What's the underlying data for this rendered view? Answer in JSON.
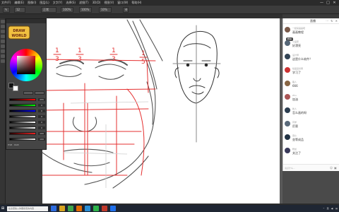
{
  "menubar": {
    "items": [
      "文件(F)",
      "编辑(E)",
      "图像(I)",
      "图层(L)",
      "文字(Y)",
      "选择(S)",
      "滤镜(T)",
      "3D(D)",
      "视图(V)",
      "窗口(W)",
      "帮助(H)"
    ]
  },
  "window_controls": {
    "minimize": "—",
    "maximize": "□",
    "close": "✕"
  },
  "options": {
    "brush_size": "12",
    "mode": "正常",
    "opacity": "100%",
    "flow": "100%",
    "smoothing": "10%"
  },
  "color_panel": {
    "slider_values": [
      "255",
      "0",
      "0",
      "0",
      "0",
      "0",
      "100",
      "100"
    ],
    "footer": "HSB · RGB"
  },
  "chat": {
    "title": "直播",
    "header_icons": [
      "⋯",
      "↻",
      "✕"
    ],
    "messages": [
      {
        "user": "一起来画画吧",
        "text": "画画教程",
        "badge": "粉丝",
        "color": "#7a5a4a"
      },
      {
        "user": "小画家",
        "text": "好漂亮",
        "badge": "",
        "color": "#556677"
      },
      {
        "user": "设计师",
        "text": "这是什么软件？",
        "badge": "",
        "color": "#334455"
      },
      {
        "user": "绘画爱好者",
        "text": "学习了",
        "badge": "",
        "color": "#cc3333"
      },
      {
        "user": "路人",
        "text": "666",
        "badge": "",
        "color": "#886644"
      },
      {
        "user": "Zhu",
        "text": "加油",
        "badge": "",
        "color": "#aa5555"
      },
      {
        "user": "新人",
        "text": "怎么画的呀",
        "badge": "",
        "color": "#2c3e50"
      },
      {
        "user": "同学",
        "text": "厉害",
        "badge": "",
        "color": "#5a6a7a"
      },
      {
        "user": "观众",
        "text": "坐等成品",
        "badge": "",
        "color": "#223344"
      },
      {
        "user": "粉丝",
        "text": "关注了",
        "badge": "",
        "color": "#3a3a5a"
      }
    ],
    "input_placeholder": "说点什么...",
    "footer_icons": [
      "☺",
      "▣"
    ]
  },
  "taskbar": {
    "start": "⊞",
    "search_placeholder": "在这里输入你要搜索的内容",
    "apps": [
      "#2d6cdf",
      "#d8a420",
      "#3ea64a",
      "#e36a00",
      "#2a8fd6",
      "#2db34a",
      "#c0392b",
      "#1f6feb"
    ],
    "tray": [
      "^",
      "英",
      "◀)",
      "▤"
    ]
  },
  "colors": {
    "photoshop_dark": "#3c3c3c",
    "canvas": "#ffffff",
    "guide_red": "#e53030",
    "sketch": "#555555"
  }
}
